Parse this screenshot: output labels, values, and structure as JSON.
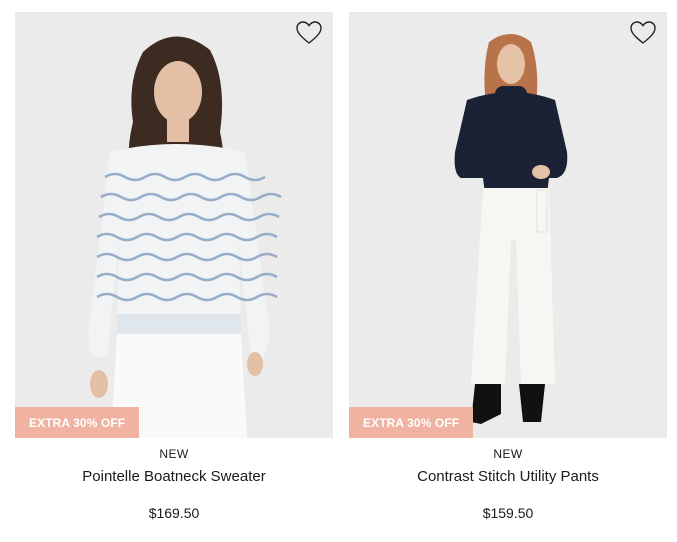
{
  "products": [
    {
      "promo": "EXTRA 30% OFF",
      "badge": "NEW",
      "name": "Pointelle Boatneck Sweater",
      "price": "$169.50",
      "image_alt": "Model wearing a light blue and white striped pointelle knit sweater with white pants",
      "wishlist_icon": "heart-outline-icon"
    },
    {
      "promo": "EXTRA 30% OFF",
      "badge": "NEW",
      "name": "Contrast Stitch Utility Pants",
      "price": "$159.50",
      "image_alt": "Model wearing a navy turtleneck sweater with white wide-leg utility pants and black boots",
      "wishlist_icon": "heart-outline-icon"
    }
  ],
  "colors": {
    "promo_bg": "#f0b3a2",
    "photo_bg": "#ebebeb",
    "text": "#1a1a1a"
  }
}
